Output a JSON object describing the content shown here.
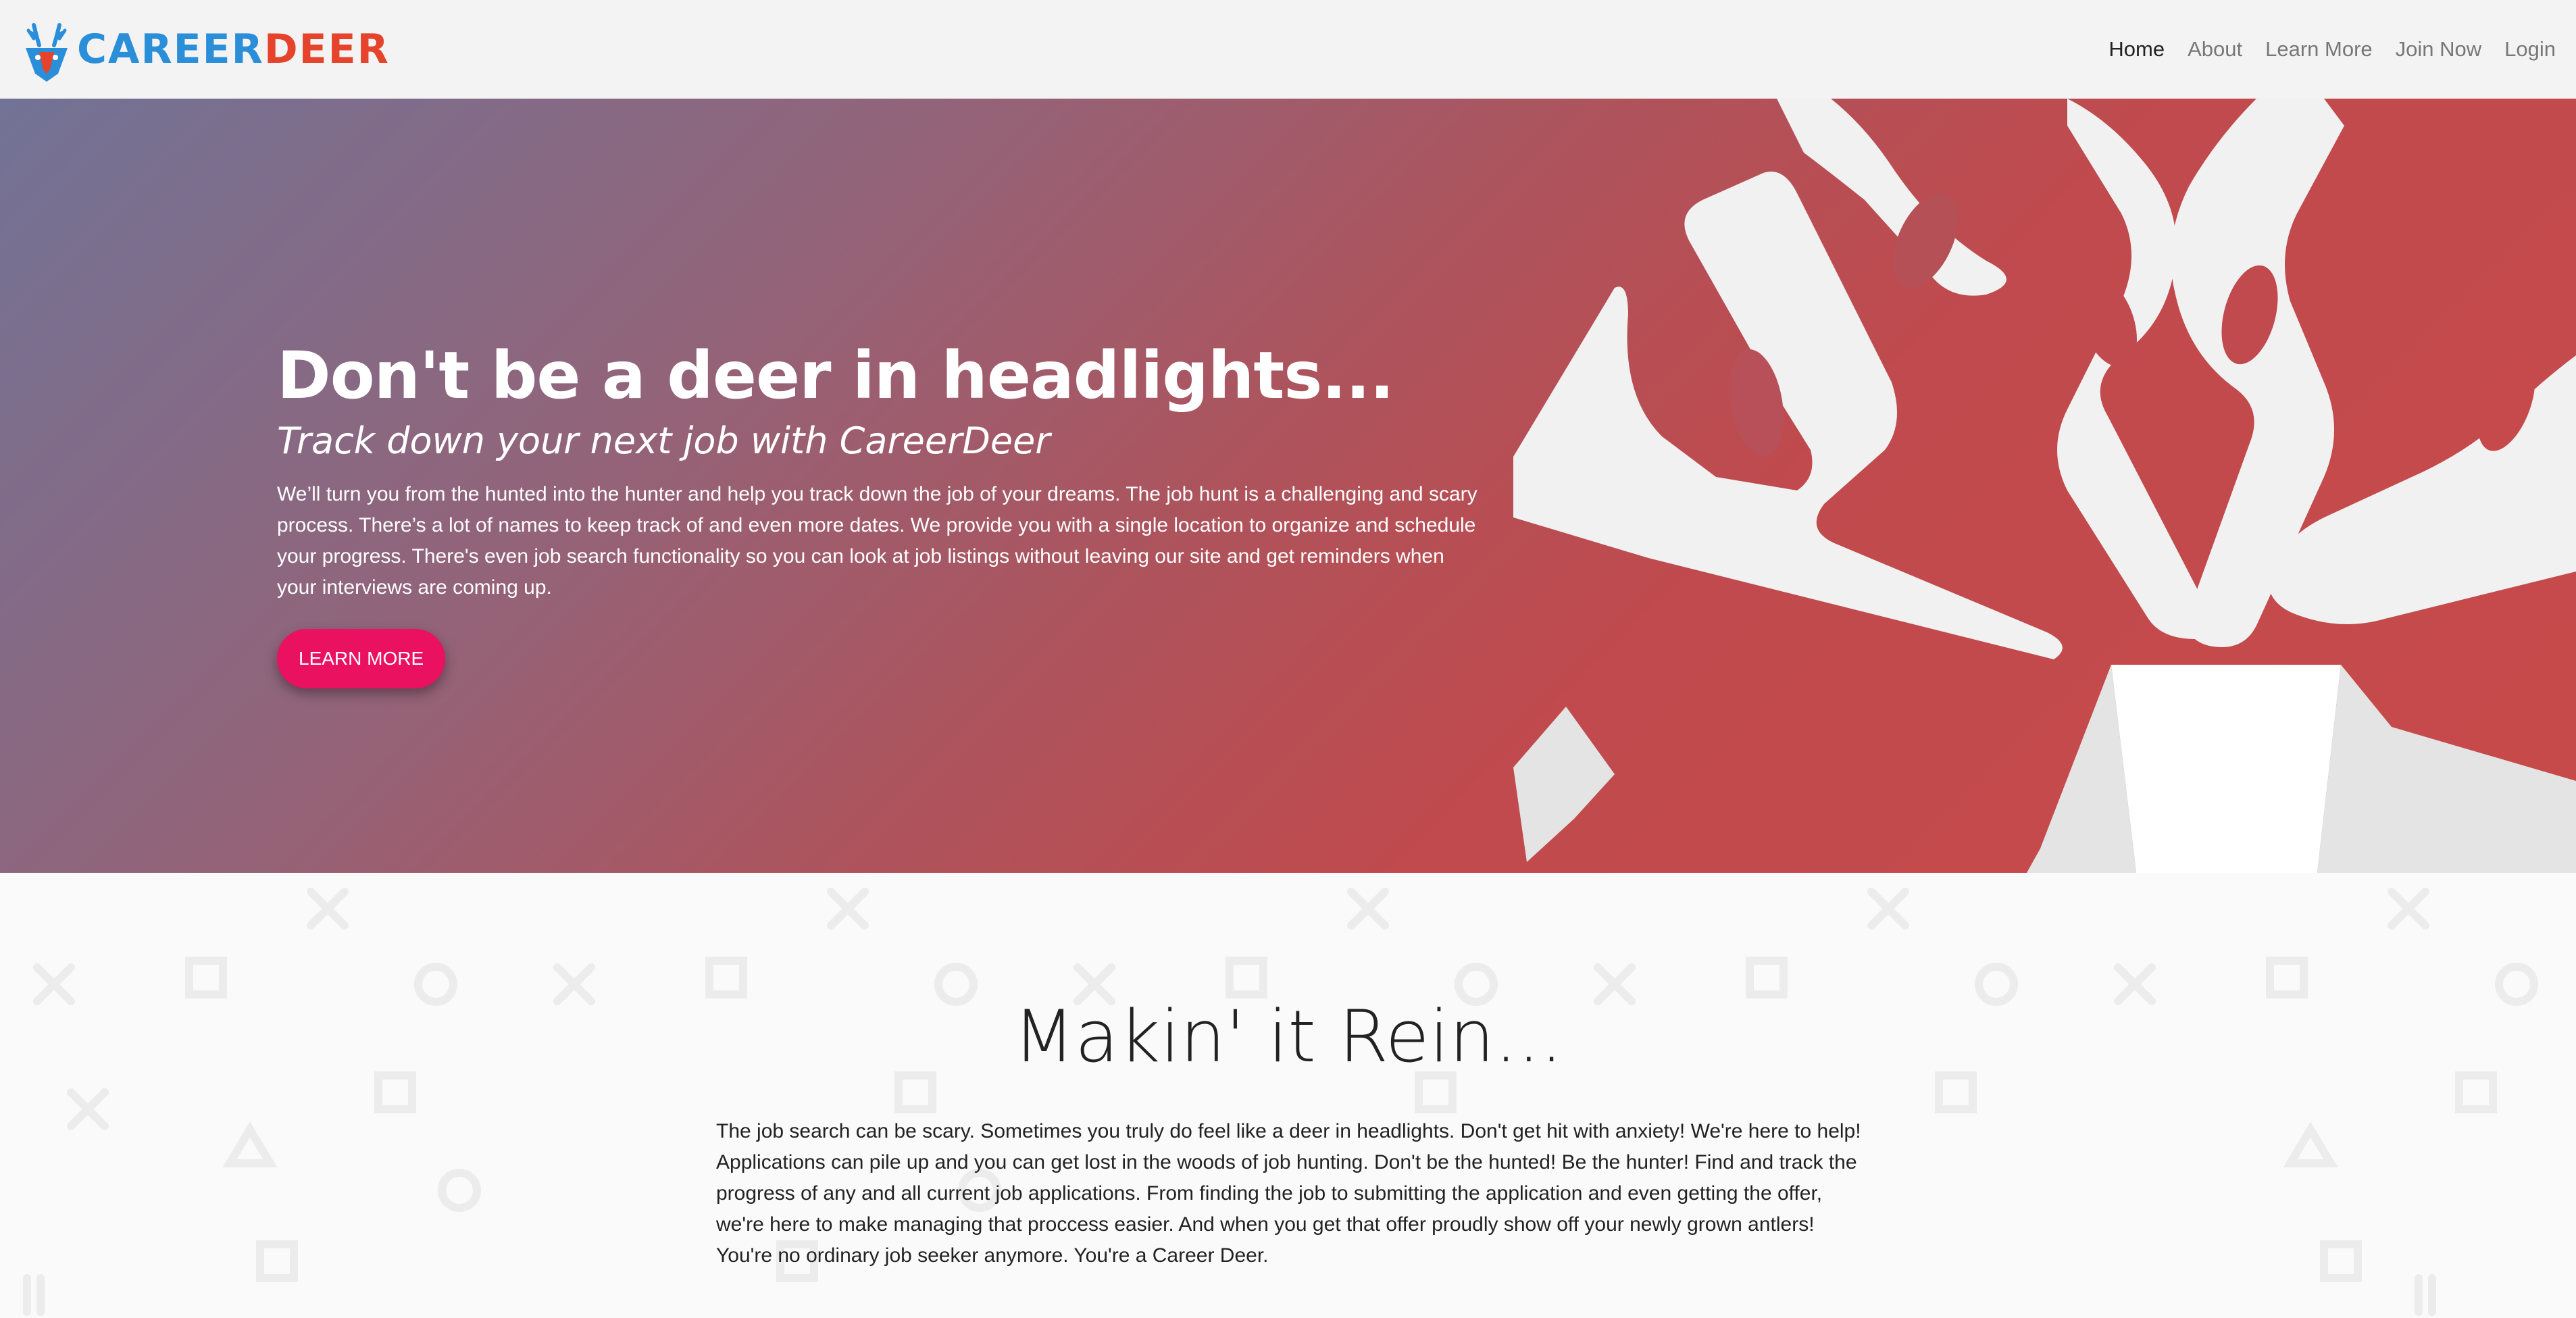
{
  "navbar": {
    "brand": {
      "part1": "CAREER",
      "part2": "DEER"
    },
    "links": [
      {
        "label": "Home",
        "active": true
      },
      {
        "label": "About",
        "active": false
      },
      {
        "label": "Learn More",
        "active": false
      },
      {
        "label": "Join Now",
        "active": false
      },
      {
        "label": "Login",
        "active": false
      }
    ]
  },
  "hero": {
    "title": "Don't be a deer in headlights...",
    "subtitle": "Track down your next job with CareerDeer",
    "text": "We’ll turn you from the hunted into the hunter and help you track down the job of your dreams. The job hunt is a challenging and scary process. There’s a lot of names to keep track of and even more dates. We provide you with a single location to organize and schedule your progress. There's even job search functionality so you can look at job listings without leaving our site and get reminders when your interviews are coming up.",
    "button_label": "LEARN MORE",
    "gradient_colors": [
      "#727396",
      "#b0525a",
      "#c84a4a"
    ]
  },
  "about": {
    "title": "Makin' it Rein...",
    "text": "The job search can be scary. Sometimes you truly do feel like a deer in headlights. Don't get hit with anxiety! We're here to help! Applications can pile up and you can get lost in the woods of job hunting. Don't be the hunted! Be the hunter! Find and track the progress of any and all current job applications. From finding the job to submitting the application and even getting the offer, we're here to make managing that proccess easier. And when you get that offer proudly show off your newly grown antlers! You're no ordinary job seeker anymore. You're a Career Deer."
  },
  "colors": {
    "brand_blue": "#2b8ed8",
    "brand_red": "#e5432b",
    "button_pink": "#ea1161"
  }
}
